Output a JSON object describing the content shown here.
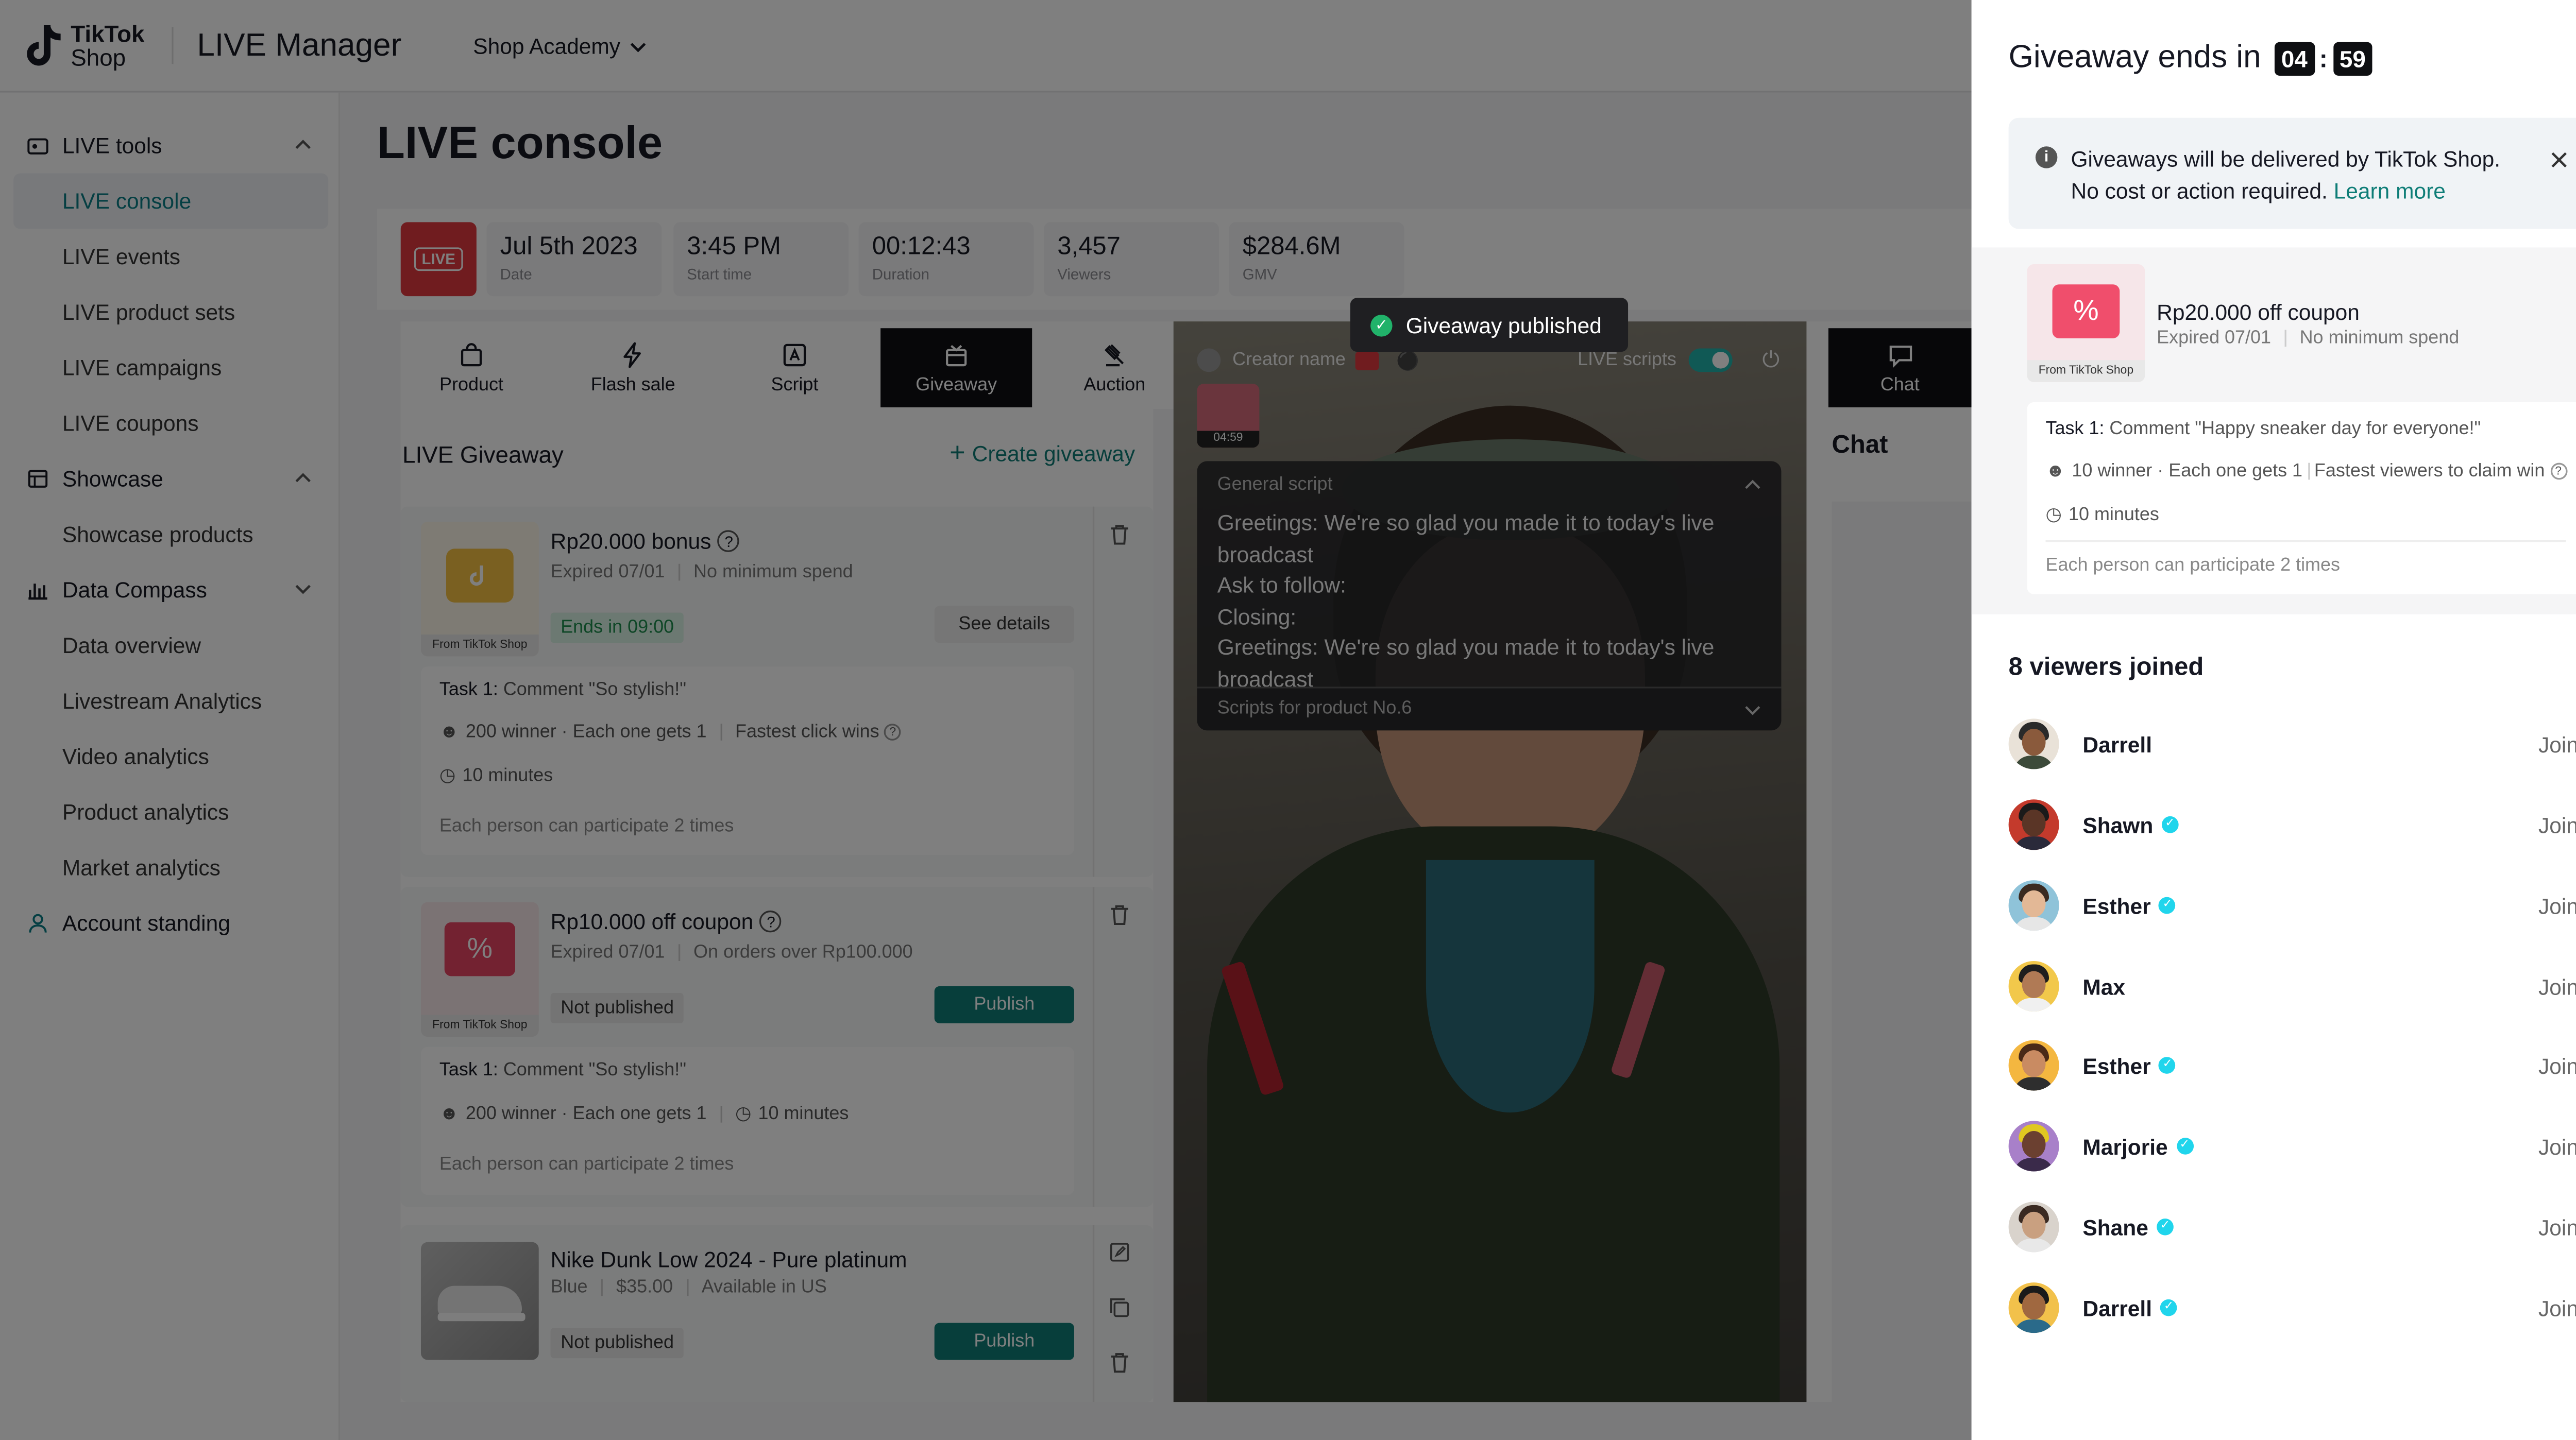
{
  "header": {
    "brand_line1": "TikTok",
    "brand_line2": "Shop",
    "app_title": "LIVE Manager",
    "academy": "Shop Academy"
  },
  "sidebar": {
    "live_tools": "LIVE tools",
    "live_items": [
      "LIVE console",
      "LIVE events",
      "LIVE product sets",
      "LIVE campaigns",
      "LIVE coupons"
    ],
    "showcase": "Showcase",
    "showcase_items": [
      "Showcase products"
    ],
    "data_compass": "Data Compass",
    "data_items": [
      "Data overview",
      "Livestream Analytics",
      "Video analytics",
      "Product analytics",
      "Market analytics"
    ],
    "account": "Account standing"
  },
  "console": {
    "title": "LIVE console",
    "live_badge": "LIVE",
    "stats": [
      {
        "value": "Jul 5th 2023",
        "label": "Date"
      },
      {
        "value": "3:45 PM",
        "label": "Start time"
      },
      {
        "value": "00:12:43",
        "label": "Duration"
      },
      {
        "value": "3,457",
        "label": "Viewers"
      },
      {
        "value": "$284.6M",
        "label": "GMV"
      }
    ],
    "tabs": [
      "Product",
      "Flash sale",
      "Script",
      "Giveaway",
      "Auction"
    ],
    "active_tab": "Giveaway"
  },
  "giveaway_panel": {
    "title": "LIVE Giveaway",
    "create": "Create giveaway",
    "from_label": "From TikTok Shop",
    "cards": [
      {
        "name": "Rp20.000 bonus",
        "expired": "Expired 07/01",
        "condition": "No minimum spend",
        "status": "Ends in 09:00",
        "action": "See details",
        "task_label": "Task 1:",
        "task": "Comment \"So stylish!\"",
        "winners": "200 winner · Each one gets 1",
        "rule": "Fastest click wins",
        "duration": "10 minutes",
        "participate": "Each person can participate 2 times"
      },
      {
        "name": "Rp10.000 off coupon",
        "expired": "Expired 07/01",
        "condition": "On orders over Rp100.000",
        "status": "Not published",
        "action": "Publish",
        "task_label": "Task 1:",
        "task": "Comment \"So stylish!\"",
        "winners": "200 winner · Each one gets 1",
        "duration": "10 minutes",
        "participate": "Each person can participate 2 times"
      },
      {
        "name": "Nike Dunk Low 2024 - Pure platinum",
        "color": "Blue",
        "price": "$35.00",
        "availability": "Available in US",
        "status": "Not published",
        "action": "Publish"
      }
    ]
  },
  "stream": {
    "creator": "Creator name",
    "scripts_toggle": "LIVE scripts",
    "mini_timer": "04:59",
    "toast": "Giveaway published",
    "script_header": "General script",
    "script_lines": [
      "Greetings: We're so glad you made it to today's live broadcast",
      "Ask to follow:",
      "Closing:",
      "Greetings: We're so glad you made it to today's live broadcast"
    ],
    "script_footer": "Scripts for product No.6"
  },
  "chat": {
    "tab": "Chat",
    "title": "Chat"
  },
  "drawer": {
    "title": "Giveaway ends in",
    "minutes": "04",
    "colon": ":",
    "seconds": "59",
    "notice": "Giveaways will be delivered by TikTok Shop.",
    "notice2": "No cost or action required.",
    "learn_more": "Learn more",
    "coupon_name": "Rp20.000 off coupon",
    "coupon_expired": "Expired 07/01",
    "coupon_condition": "No minimum spend",
    "from_label": "From TikTok Shop",
    "task_label": "Task 1:",
    "task": "Comment \"Happy sneaker day for everyone!\"",
    "winners": "10 winner · Each one gets 1",
    "rule": "Fastest viewers to claim win",
    "duration": "10 minutes",
    "participate": "Each person can participate 2 times",
    "joined_title": "8 viewers joined",
    "viewers": [
      {
        "name": "Darrell",
        "status": "Joined",
        "verified": false,
        "skin": "#8a5a3c",
        "bg": "#e9e2d8",
        "hair": "#2a2a2a",
        "shirt": "#3c4a3a"
      },
      {
        "name": "Shawn",
        "status": "Joined",
        "verified": true,
        "skin": "#5a3526",
        "bg": "#c43a2c",
        "hair": "#1a1a1a",
        "shirt": "#2a2a3a"
      },
      {
        "name": "Esther",
        "status": "Joined",
        "verified": true,
        "skin": "#e3b896",
        "bg": "#8fc3d9",
        "hair": "#3a2a20",
        "shirt": "#e6e6e6"
      },
      {
        "name": "Max",
        "status": "Joined",
        "verified": false,
        "skin": "#b07a55",
        "bg": "#f2c84b",
        "hair": "#1e1e1e",
        "shirt": "#f0f0f0"
      },
      {
        "name": "Esther",
        "status": "Joined",
        "verified": true,
        "skin": "#c98b62",
        "bg": "#f4b740",
        "hair": "#4a2a18",
        "shirt": "#2e2e2e"
      },
      {
        "name": "Marjorie",
        "status": "Joined",
        "verified": true,
        "skin": "#6b4030",
        "bg": "#a880c9",
        "hair": "#e0c820",
        "shirt": "#3a2a4a"
      },
      {
        "name": "Shane",
        "status": "Joined",
        "verified": true,
        "skin": "#c9a080",
        "bg": "#d9d3cc",
        "hair": "#3a2a22",
        "shirt": "#e8e8e8"
      },
      {
        "name": "Darrell",
        "status": "Joined",
        "verified": true,
        "skin": "#a06840",
        "bg": "#f2c14b",
        "hair": "#1a1a1a",
        "shirt": "#2a6a8a"
      }
    ]
  }
}
